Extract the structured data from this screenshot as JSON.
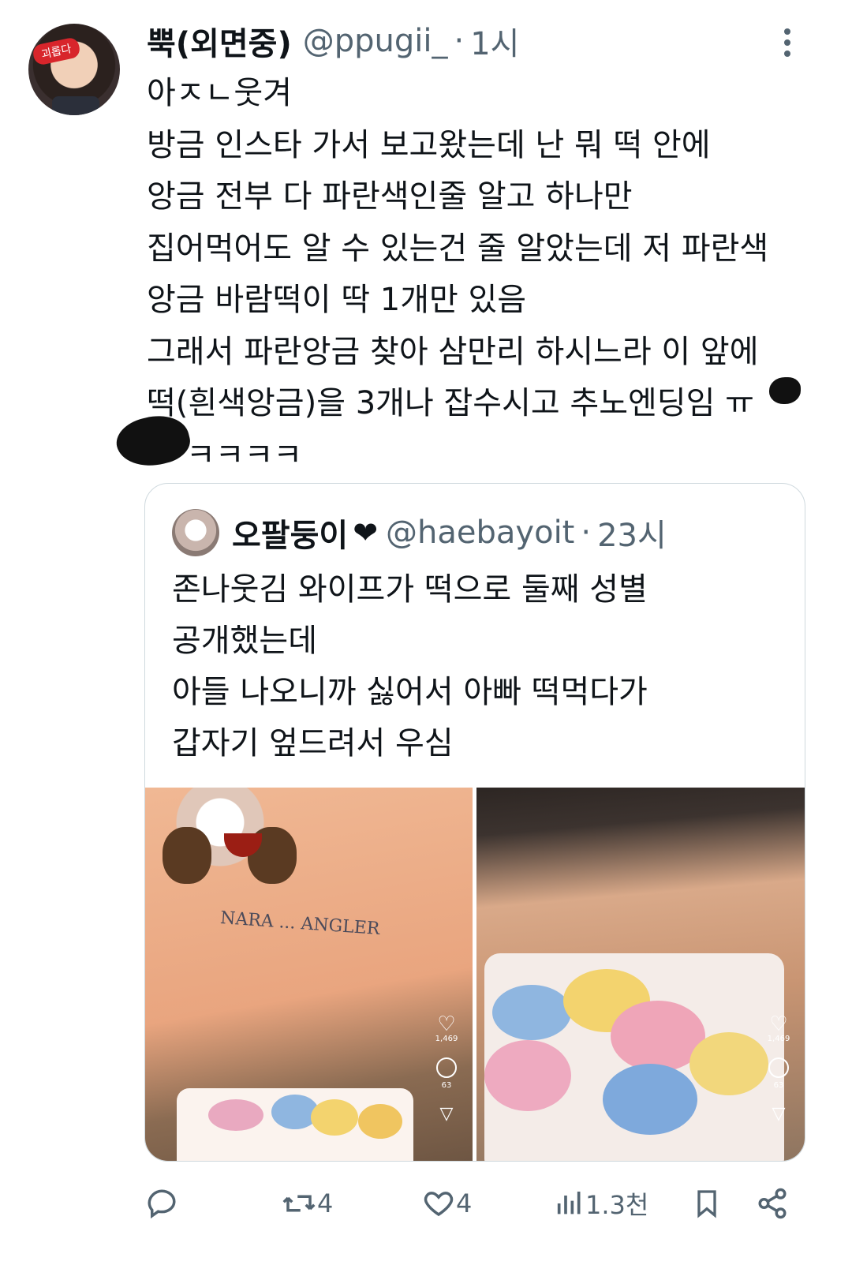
{
  "tweet": {
    "author_name": "뿍(외면중)",
    "handle": "@ppugii_",
    "separator": "·",
    "time": "1시",
    "avatar_badge": "괴롭다",
    "lines": [
      "아ㅈㄴ웃겨",
      "방금 인스타 가서 보고왔는데 난 뭐 떡 안에",
      "앙금 전부 다 파란색인줄 알고 하나만",
      "집어먹어도 알 수 있는건 줄 알았는데 저 파란색",
      "앙금 바람떡이 딱 1개만 있음",
      "그래서 파란앙금 찾아 삼만리 하시느라 이 앞에",
      "떡(흰색앙금)을 3개나 잡수시고 추노엔딩임 ㅠ",
      "ㅋㅋㅋㅋ"
    ]
  },
  "quoted": {
    "author_name": "오팔둥이",
    "handle": "@haebayoit",
    "separator": "·",
    "time": "23시",
    "lines": [
      "존나웃김 와이프가 떡으로 둘째 성별",
      "공개했는데",
      "아들 나오니까 싫어서 아빠 떡먹다가",
      "갑자기 엎드려서 우심"
    ],
    "media": [
      {
        "shirt_text": "NARA ... ANGLER",
        "likes": "1,469",
        "comments": "63"
      },
      {
        "likes": "1,469",
        "comments": "63"
      }
    ]
  },
  "actions": {
    "reply_count": "",
    "retweet_count": "4",
    "like_count": "4",
    "views": "1.3천"
  },
  "colors": {
    "text": "#0f1419",
    "secondary": "#536471",
    "border": "#cfd9de"
  }
}
